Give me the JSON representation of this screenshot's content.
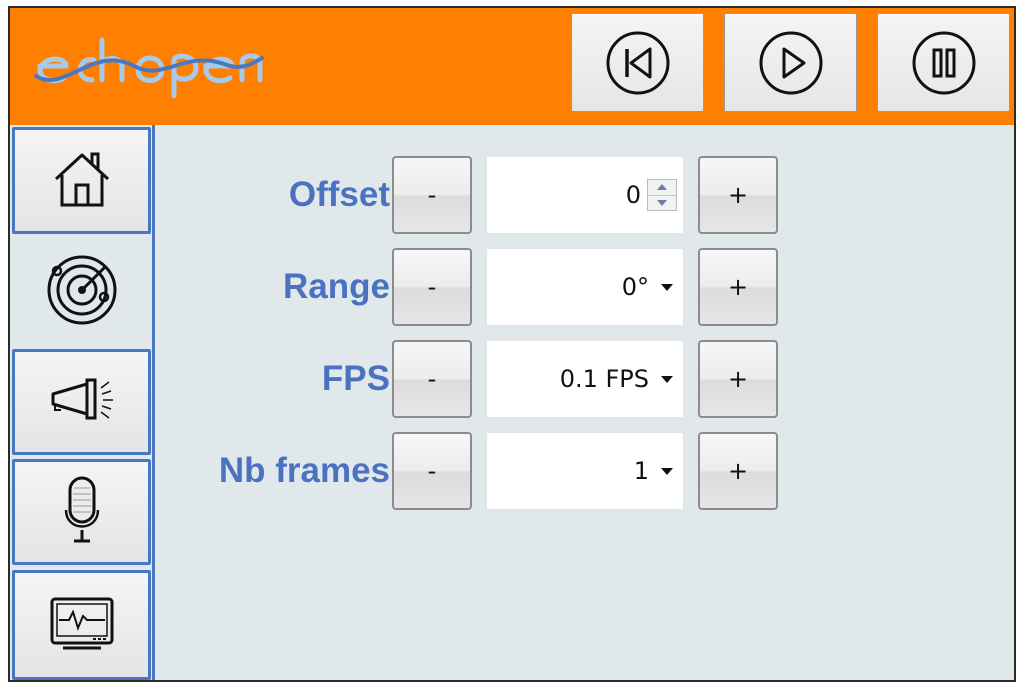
{
  "app": {
    "logo_text": "echopen",
    "colors": {
      "header": "#ff8000",
      "accent": "#4a72c0",
      "panel": "#e1e8eb"
    }
  },
  "header_buttons": [
    {
      "name": "skip-back-button",
      "icon": "skip-back-icon"
    },
    {
      "name": "play-button",
      "icon": "play-icon"
    },
    {
      "name": "pause-button",
      "icon": "pause-icon"
    }
  ],
  "sidebar": [
    {
      "name": "sidebar-item-home",
      "icon": "home-icon",
      "active": false
    },
    {
      "name": "sidebar-item-scan",
      "icon": "radar-icon",
      "active": true
    },
    {
      "name": "sidebar-item-emitter",
      "icon": "megaphone-icon",
      "active": false
    },
    {
      "name": "sidebar-item-receiver",
      "icon": "microphone-icon",
      "active": false
    },
    {
      "name": "sidebar-item-monitor",
      "icon": "monitor-icon",
      "active": false
    }
  ],
  "form": {
    "offset": {
      "label": "Offset",
      "value": "0",
      "minus": "-",
      "plus": "+"
    },
    "range": {
      "label": "Range",
      "value": "0°",
      "minus": "-",
      "plus": "+"
    },
    "fps": {
      "label": "FPS",
      "value": "0.1 FPS",
      "minus": "-",
      "plus": "+"
    },
    "nb_frames": {
      "label": "Nb frames",
      "value": "1",
      "minus": "-",
      "plus": "+"
    }
  }
}
